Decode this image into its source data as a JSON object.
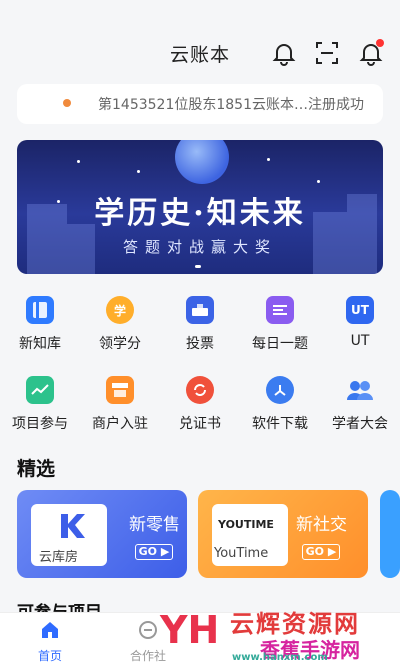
{
  "header": {
    "title": "云账本"
  },
  "notice": {
    "text": "第1453521位股东1851云账本…注册成功"
  },
  "banner": {
    "title": "学历史·知未来",
    "subtitle": "答题对战赢大奖"
  },
  "menu": [
    {
      "label": "新知库",
      "icon": "book-icon",
      "color": "#2f7bff"
    },
    {
      "label": "领学分",
      "icon": "study-badge-icon",
      "color": "#ffae2b",
      "glyph": "学"
    },
    {
      "label": "投票",
      "icon": "ballot-box-icon",
      "color": "#3b63e6"
    },
    {
      "label": "每日一题",
      "icon": "daily-question-icon",
      "color": "#8a5cf0"
    },
    {
      "label": "UT",
      "icon": "ut-icon",
      "color": "#2f67f0",
      "glyph": "UT"
    },
    {
      "label": "项目参与",
      "icon": "trend-chart-icon",
      "color": "#2cc28c"
    },
    {
      "label": "商户入驻",
      "icon": "storefront-icon",
      "color": "#ff8f2b"
    },
    {
      "label": "兑证书",
      "icon": "exchange-icon",
      "color": "#f0513b"
    },
    {
      "label": "软件下载",
      "icon": "download-hub-icon",
      "color": "#3b7cf0"
    },
    {
      "label": "学者大会",
      "icon": "people-icon",
      "color": "#3a78ee"
    }
  ],
  "featured": {
    "title": "精选",
    "cards": [
      {
        "name": "新零售",
        "logo_text": "云库房",
        "go": "GO"
      },
      {
        "name": "新社交",
        "logo_text": "YouTime",
        "logo_brand": "YOUTIME",
        "go": "GO"
      }
    ]
  },
  "next_section": {
    "title": "可参与项目"
  },
  "tabs": [
    {
      "label": "首页",
      "active": true
    },
    {
      "label": "合作社",
      "active": false
    }
  ],
  "watermark": {
    "yh": "YH",
    "line1": "云辉资源网",
    "line2": "香蕉手游网",
    "url": "www.hanxm.com"
  },
  "colors": {
    "accent": "#2f6bff",
    "banner_bg": "#1e2a7e"
  }
}
